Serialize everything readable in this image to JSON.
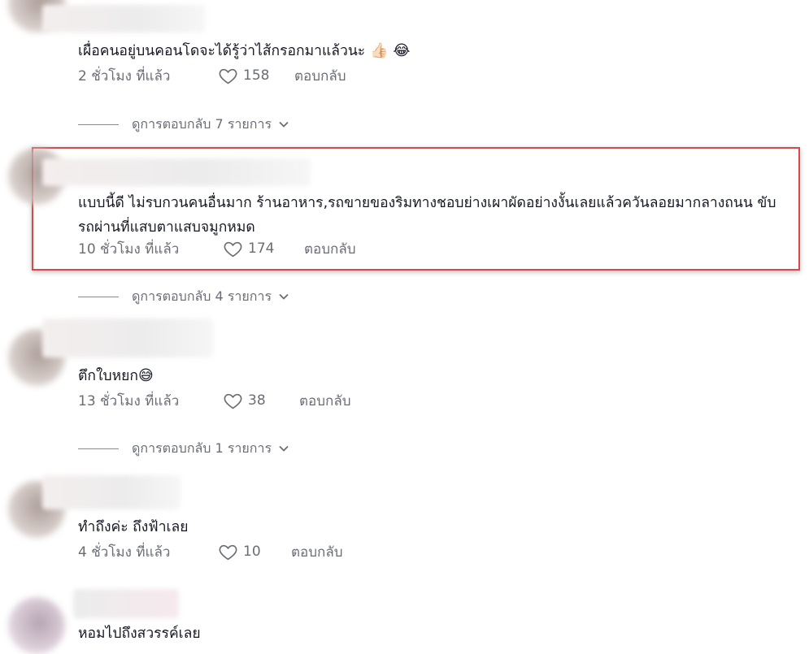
{
  "comments": [
    {
      "text": "เผื่อคนอยู่บนคอนโดจะได้รู้ว่าไส้กรอกมาแล้วนะ",
      "emoji": "👍🏻 😂",
      "time": "2 ชั่วโมง ที่แล้ว",
      "likes": "158",
      "reply": "ตอบกลับ",
      "view_replies": "ดูการตอบกลับ 7 รายการ"
    },
    {
      "text": "แบบนี้ดี ไม่รบกวนคนอื่นมาก ร้านอาหาร,รถขายของริมทางชอบย่างเผาผัดอย่างงั้นเลยแล้วควันลอยมากลางถนน ขับรถผ่านที่แสบตาแสบจมูกหมด",
      "time": "10 ชั่วโมง ที่แล้ว",
      "likes": "174",
      "reply": "ตอบกลับ",
      "view_replies": "ดูการตอบกลับ 4 รายการ"
    },
    {
      "text": "ตึกใบหยก",
      "emoji": "😅",
      "time": "13 ชั่วโมง ที่แล้ว",
      "likes": "38",
      "reply": "ตอบกลับ",
      "view_replies": "ดูการตอบกลับ 1 รายการ"
    },
    {
      "text": "ทำถึงค่ะ ถึงฟ้าเลย",
      "time": "4 ชั่วโมง ที่แล้ว",
      "likes": "10",
      "reply": "ตอบกลับ"
    },
    {
      "text": "หอมไปถึงสวรรค์เลย"
    }
  ],
  "colors": {
    "highlight_border": "#d8494b",
    "meta_text": "#6b6d76"
  },
  "icons": {
    "like": "heart-outline-icon",
    "expand": "chevron-down-icon"
  }
}
